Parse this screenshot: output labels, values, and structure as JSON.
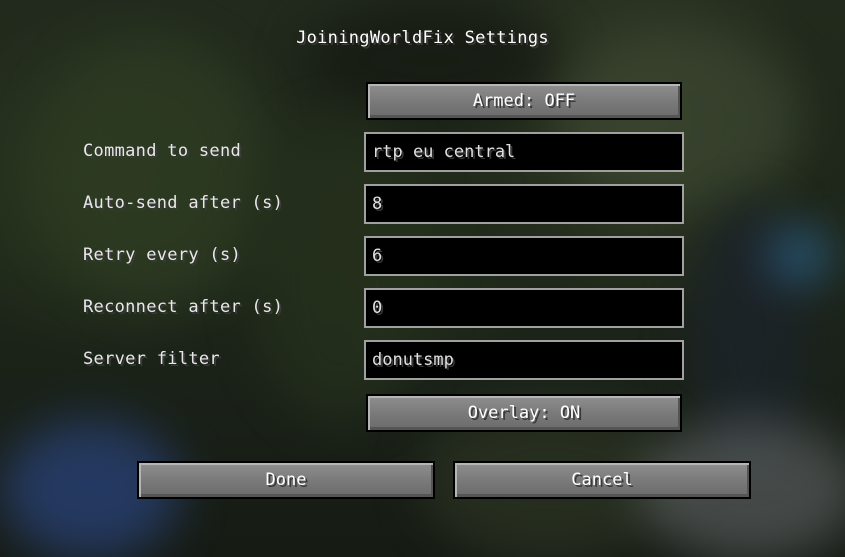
{
  "screen": {
    "title": "JoiningWorldFix Settings"
  },
  "toggles": {
    "armed_label": "Armed: OFF",
    "overlay_label": "Overlay: ON"
  },
  "fields": [
    {
      "label": "Command to send",
      "value": "rtp eu central"
    },
    {
      "label": "Auto-send after (s)",
      "value": "8"
    },
    {
      "label": "Retry every (s)",
      "value": "6"
    },
    {
      "label": "Reconnect after (s)",
      "value": "0"
    },
    {
      "label": "Server filter",
      "value": "donutsmp"
    }
  ],
  "footer": {
    "done_label": "Done",
    "cancel_label": "Cancel"
  },
  "colors": {
    "button_face": "#7a7a7a",
    "field_background": "#000000",
    "field_border": "#a0a0a0",
    "text": "#e0e0e0"
  }
}
